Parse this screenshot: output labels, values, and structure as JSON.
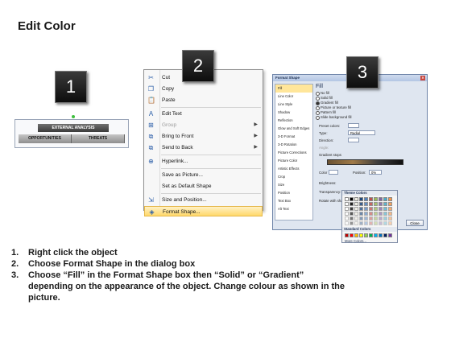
{
  "title": "Edit Color",
  "badges": [
    "1",
    "2",
    "3"
  ],
  "panel1": {
    "top_label": "EXTERNAL ANALYSIS",
    "cells": [
      "OPPORTUNITIES",
      "THREATS"
    ]
  },
  "context_menu": {
    "items": [
      {
        "icon": "cut-icon",
        "label": "Cut",
        "disabled": false,
        "submenu": false
      },
      {
        "icon": "copy-icon",
        "label": "Copy",
        "disabled": false,
        "submenu": false
      },
      {
        "icon": "paste-icon",
        "label": "Paste",
        "disabled": false,
        "submenu": false
      },
      {
        "icon": "edit-text-icon",
        "label": "Edit Text",
        "disabled": false,
        "submenu": false
      },
      {
        "icon": "group-icon",
        "label": "Group",
        "disabled": true,
        "submenu": true
      },
      {
        "icon": "bring-to-front-icon",
        "label": "Bring to Front",
        "disabled": false,
        "submenu": true
      },
      {
        "icon": "send-to-back-icon",
        "label": "Send to Back",
        "disabled": false,
        "submenu": true
      },
      {
        "icon": "hyperlink-icon",
        "label": "Hyperlink...",
        "disabled": false,
        "submenu": false
      },
      {
        "icon": "",
        "label": "Save as Picture...",
        "disabled": false,
        "submenu": false
      },
      {
        "icon": "",
        "label": "Set as Default Shape",
        "disabled": false,
        "submenu": false
      },
      {
        "icon": "size-position-icon",
        "label": "Size and Position...",
        "disabled": false,
        "submenu": false
      },
      {
        "icon": "format-shape-icon",
        "label": "Format Shape...",
        "disabled": false,
        "submenu": false,
        "highlighted": true
      }
    ]
  },
  "format_dialog": {
    "title": "Format Shape",
    "categories": [
      "Fill",
      "Line Color",
      "Line Style",
      "Shadow",
      "Reflection",
      "Glow and Soft Edges",
      "3-D Format",
      "3-D Rotation",
      "Picture Corrections",
      "Picture Color",
      "Artistic Effects",
      "Crop",
      "Size",
      "Position",
      "Text Box",
      "Alt Text"
    ],
    "pane_heading": "Fill",
    "fill_options": [
      "No fill",
      "Solid fill",
      "Gradient fill",
      "Picture or texture fill",
      "Pattern fill",
      "Slide background fill"
    ],
    "selected_option": "Gradient fill",
    "preset_colors_label": "Preset colors:",
    "type_label": "Type:",
    "type_value": "Radial",
    "direction_label": "Direction:",
    "angle_label": "Angle:",
    "gradient_stops_label": "Gradient stops",
    "color_label": "Color",
    "position_label": "Position:",
    "position_value": "0%",
    "brightness_label": "Brightness:",
    "transparency_label": "Transparency:",
    "rotate_label": "Rotate with shape",
    "close_label": "Close",
    "theme_colors_label": "Theme Colors",
    "standard_colors_label": "Standard Colors",
    "more_colors_label": "More Colors...",
    "palette_colors": [
      "#ffffff",
      "#000000",
      "#eeece1",
      "#1f497d",
      "#4f81bd",
      "#c0504d",
      "#9bbb59",
      "#8064a2",
      "#4bacc6",
      "#f79646"
    ],
    "standard_colors": [
      "#c00000",
      "#ff0000",
      "#ffc000",
      "#ffff00",
      "#92d050",
      "#00b050",
      "#00b0f0",
      "#0070c0",
      "#002060",
      "#7030a0"
    ]
  },
  "steps": [
    {
      "num": "1.",
      "text": "Right click the object"
    },
    {
      "num": "2.",
      "text": "Choose Format Shape in the dialog box"
    },
    {
      "num": "3.",
      "text": "Choose “Fill” in the Format Shape box then “Solid” or “Gradient” depending on the appearance of the object. Change colour as shown in the picture."
    }
  ]
}
